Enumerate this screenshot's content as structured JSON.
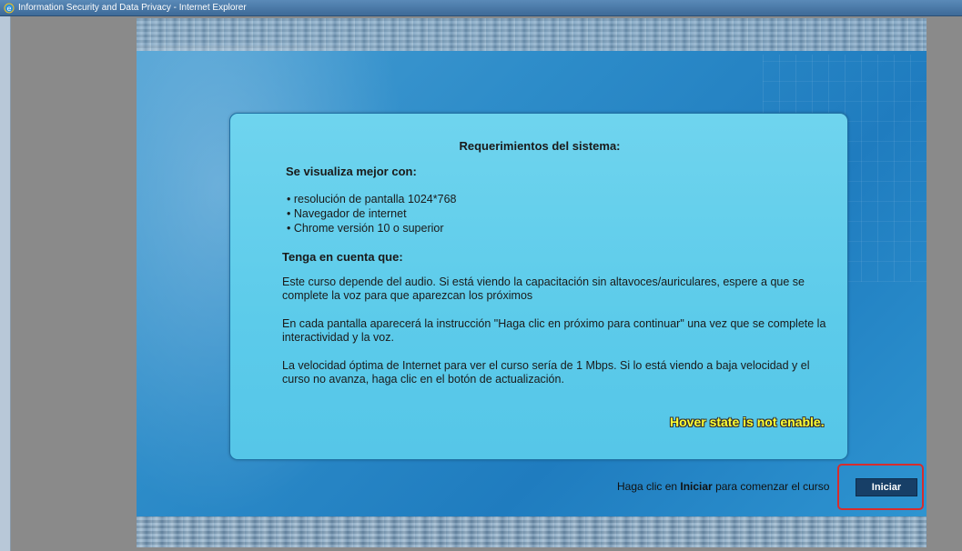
{
  "window": {
    "title": "Information Security and Data Privacy - Internet Explorer",
    "icon": "internet-explorer-icon"
  },
  "panel": {
    "title": "Requerimientos del sistema:",
    "section1_heading": "Se visualiza mejor con:",
    "requirements": [
      "resolución de pantalla 1024*768",
      "Navegador de internet",
      "Chrome versión 10 o superior"
    ],
    "section2_heading": "Tenga en cuenta que:",
    "notes": [
      "Este curso depende del audio. Si está viendo la capacitación sin altavoces/auriculares, espere a que se complete la voz para que aparezcan los próximos",
      "En cada pantalla aparecerá la instrucción \"Haga clic en próximo para continuar\" una vez que se complete la interactividad y la voz.",
      "La velocidad óptima de Internet para ver el curso sería de 1 Mbps. Si lo está viendo a baja velocidad y el curso no avanza, haga clic en el botón de actualización."
    ]
  },
  "annotation": "Hover state is not enable.",
  "footer": {
    "prefix": "Haga clic en ",
    "bold": "Iniciar",
    "suffix": " para comenzar el curso",
    "start_label": "Iniciar"
  },
  "colors": {
    "annotation": "#ffff33",
    "highlight": "#d62d2d",
    "button": "#173f67"
  }
}
